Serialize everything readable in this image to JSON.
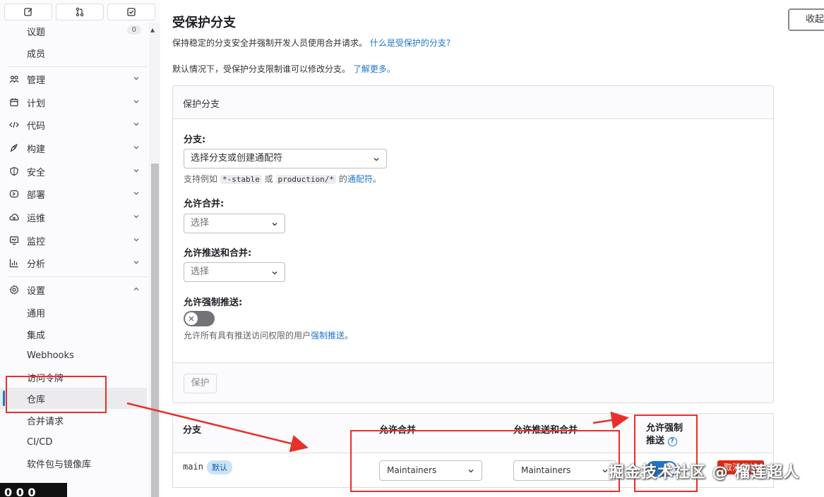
{
  "sidebar": {
    "top_buttons": [
      "edit-icon",
      "merge-request-icon",
      "todo-icon"
    ],
    "issues_label": "议题",
    "issues_count": "0",
    "members_label": "成员",
    "sections": [
      {
        "label": "管理",
        "icon": "users-icon"
      },
      {
        "label": "计划",
        "icon": "calendar-icon"
      },
      {
        "label": "代码",
        "icon": "code-icon"
      },
      {
        "label": "构建",
        "icon": "rocket-icon"
      },
      {
        "label": "安全",
        "icon": "shield-icon"
      },
      {
        "label": "部署",
        "icon": "deployments-icon"
      },
      {
        "label": "运维",
        "icon": "cloud-icon"
      },
      {
        "label": "监控",
        "icon": "monitor-icon"
      },
      {
        "label": "分析",
        "icon": "chart-icon"
      }
    ],
    "settings_label": "设置",
    "settings_items": [
      "通用",
      "集成",
      "Webhooks",
      "访问令牌",
      "仓库",
      "合并请求",
      "CI/CD",
      "软件包与镜像库"
    ],
    "active_item": "仓库",
    "bottom_overlay_text": "0 0 0"
  },
  "main": {
    "title": "受保护分支",
    "collapse_label": "收起",
    "desc1": "保持稳定的分支安全并强制开发人员使用合并请求。",
    "desc1_link": "什么是受保护的分支?",
    "desc2": "默认情况下，受保护分支限制谁可以修改分支。",
    "desc2_link": "了解更多。",
    "form": {
      "header": "保护分支",
      "branch_label": "分支:",
      "branch_placeholder": "选择分支或创建通配符",
      "branch_help_prefix": "支持例如",
      "branch_help_code1": "*-stable",
      "branch_help_or": "或",
      "branch_help_code2": "production/*",
      "branch_help_of": "的",
      "branch_help_link": "通配符",
      "branch_help_end": "。",
      "merge_label": "允许合并:",
      "merge_placeholder": "选择",
      "push_merge_label": "允许推送和合并:",
      "push_merge_placeholder": "选择",
      "force_push_label": "允许强制推送:",
      "force_push_help": "允许所有具有推送访问权限的用户",
      "force_push_help_link": "强制推送",
      "force_push_help_end": "。",
      "protect_button": "保护"
    },
    "table": {
      "headers": {
        "branch": "分支",
        "merge": "允许合并",
        "push_merge": "允许推送和合并",
        "force_push_1": "允许强制",
        "force_push_2": "推送"
      },
      "rows": [
        {
          "branch": "main",
          "badge": "默认",
          "merge": "Maintainers",
          "push_merge": "Maintainers",
          "force_push": true,
          "unprotect": "取消保护"
        }
      ]
    }
  },
  "watermark": "掘金技术社区 @ 榴莲超人",
  "colors": {
    "annotation": "#e8302a",
    "link": "#1f75cb",
    "toggle_on": "#1f75cb",
    "danger": "#dd2b0e"
  }
}
